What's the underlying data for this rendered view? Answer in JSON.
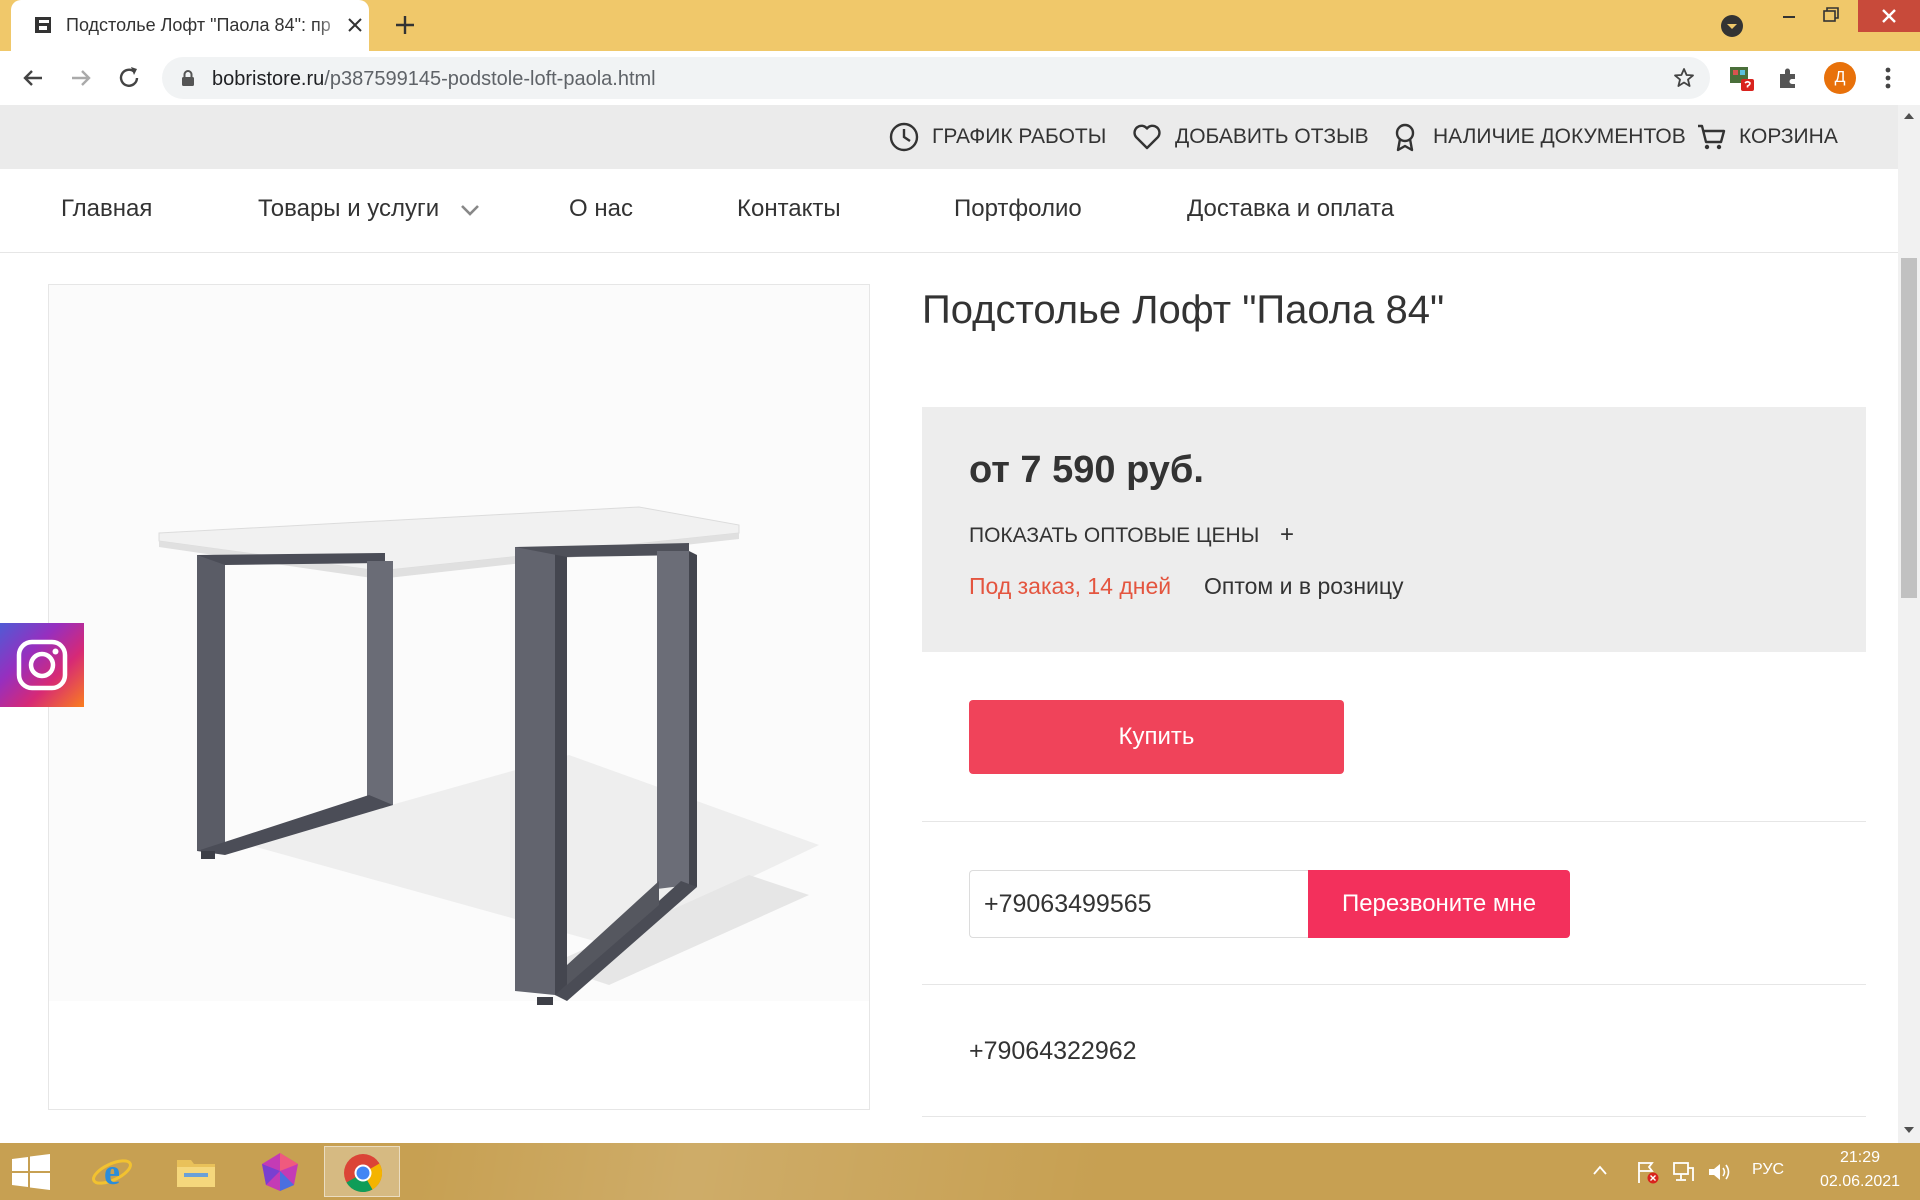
{
  "browser": {
    "tab_title": "Подстолье Лофт \"Паола 84\": пр",
    "url_domain": "bobristore.ru",
    "url_path": "/p387599145-podstole-loft-paola.html",
    "profile_initial": "Д"
  },
  "topbar": {
    "schedule": "ГРАФИК РАБОТЫ",
    "review": "ДОБАВИТЬ ОТЗЫВ",
    "documents": "НАЛИЧИЕ ДОКУМЕНТОВ",
    "cart": "КОРЗИНА"
  },
  "nav": {
    "home": "Главная",
    "goods": "Товары и услуги",
    "about": "О нас",
    "contacts": "Контакты",
    "portfolio": "Портфолио",
    "delivery": "Доставка и оплата"
  },
  "product": {
    "title": "Подстолье Лофт \"Паола 84\"",
    "price": "от 7 590 руб.",
    "wholesale_link": "ПОКАЗАТЬ ОПТОВЫЕ ЦЕНЫ",
    "wholesale_plus": "+",
    "availability": "Под заказ, 14 дней",
    "sale_type": "Оптом и в розницу",
    "buy_label": "Купить"
  },
  "callback": {
    "phone_value": "+79063499565",
    "button_label": "Перезвоните мне"
  },
  "contacts": {
    "phone_2": "+79064322962"
  },
  "taskbar": {
    "language": "РУС",
    "time": "21:29",
    "date": "02.06.2021"
  },
  "colors": {
    "titlebar": "#f0c86a",
    "buy_button": "#f0435a",
    "callback_button": "#f3305c",
    "availability_text": "#e4553f",
    "taskbar": "#c7a052"
  }
}
